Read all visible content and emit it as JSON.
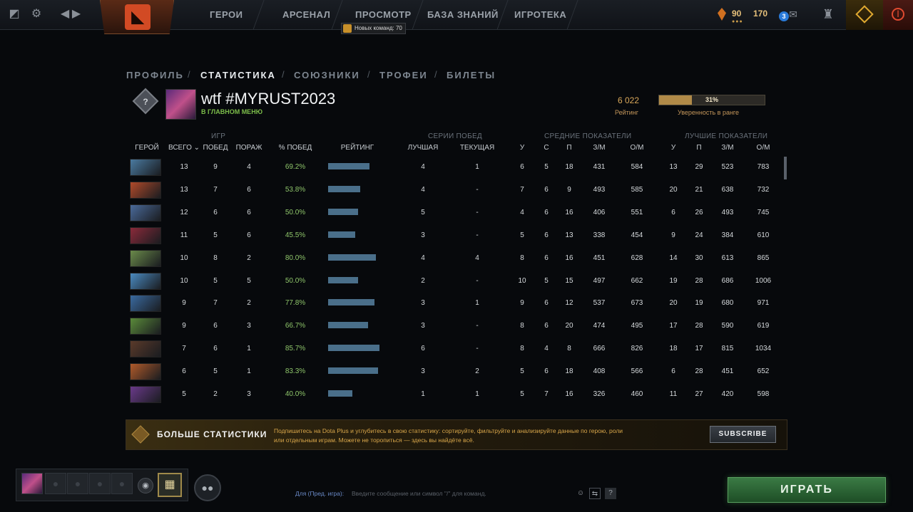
{
  "topbar": {
    "nav": [
      "ГЕРОИ",
      "АРСЕНАЛ",
      "ПРОСМОТР",
      "БАЗА ЗНАНИЙ",
      "ИГРОТЕКА"
    ],
    "notification": "Новых команд: 70",
    "currency_1": "90",
    "currency_2": "170",
    "badge_count": "3",
    "icons": [
      "dota-logo-icon",
      "settings-icon",
      "back-icon",
      "forward-icon",
      "shards-icon",
      "mail-icon",
      "armory-icon",
      "dota-plus-icon",
      "power-icon"
    ]
  },
  "tabs": [
    "ПРОФИЛЬ",
    "СТАТИСТИКА",
    "СОЮЗНИКИ",
    "ТРОФЕИ",
    "БИЛЕТЫ"
  ],
  "active_tab": "СТАТИСТИКА",
  "profile": {
    "name": "wtf #MYRUST2023",
    "status": "В ГЛАВНОМ МЕНЮ",
    "rating_value": "6 022",
    "rating_label": "Рейтинг",
    "confidence_value": "31%",
    "confidence_fraction": 0.31,
    "confidence_label": "Уверенность в ранге"
  },
  "table": {
    "groups": {
      "games": "ИГР",
      "streaks": "СЕРИИ ПОБЕД",
      "averages": "СРЕДНИЕ ПОКАЗАТЕЛИ",
      "bests": "ЛУЧШИЕ ПОКАЗАТЕЛИ"
    },
    "columns": [
      "ГЕРОЙ",
      "ВСЕГО",
      "ПОБЕД",
      "ПОРАЖ",
      "% ПОБЕД",
      "РЕЙТИНГ",
      "ЛУЧШАЯ",
      "ТЕКУЩАЯ",
      "У",
      "С",
      "П",
      "З/М",
      "О/М",
      "У",
      "П",
      "З/М",
      "О/М"
    ],
    "rows": [
      {
        "total": "13",
        "wins": "9",
        "losses": "4",
        "winrate": "69.2%",
        "rating": 0.69,
        "best": "4",
        "current": "1",
        "avg_k": "6",
        "avg_d": "5",
        "avg_a": "18",
        "avg_gpm": "431",
        "avg_xpm": "584",
        "best_k": "13",
        "best_a": "29",
        "best_gpm": "523",
        "best_xpm": "783"
      },
      {
        "total": "13",
        "wins": "7",
        "losses": "6",
        "winrate": "53.8%",
        "rating": 0.54,
        "best": "4",
        "current": "-",
        "avg_k": "7",
        "avg_d": "6",
        "avg_a": "9",
        "avg_gpm": "493",
        "avg_xpm": "585",
        "best_k": "20",
        "best_a": "21",
        "best_gpm": "638",
        "best_xpm": "732"
      },
      {
        "total": "12",
        "wins": "6",
        "losses": "6",
        "winrate": "50.0%",
        "rating": 0.5,
        "best": "5",
        "current": "-",
        "avg_k": "4",
        "avg_d": "6",
        "avg_a": "16",
        "avg_gpm": "406",
        "avg_xpm": "551",
        "best_k": "6",
        "best_a": "26",
        "best_gpm": "493",
        "best_xpm": "745"
      },
      {
        "total": "11",
        "wins": "5",
        "losses": "6",
        "winrate": "45.5%",
        "rating": 0.455,
        "best": "3",
        "current": "-",
        "avg_k": "5",
        "avg_d": "6",
        "avg_a": "13",
        "avg_gpm": "338",
        "avg_xpm": "454",
        "best_k": "9",
        "best_a": "24",
        "best_gpm": "384",
        "best_xpm": "610"
      },
      {
        "total": "10",
        "wins": "8",
        "losses": "2",
        "winrate": "80.0%",
        "rating": 0.8,
        "best": "4",
        "current": "4",
        "avg_k": "8",
        "avg_d": "6",
        "avg_a": "16",
        "avg_gpm": "451",
        "avg_xpm": "628",
        "best_k": "14",
        "best_a": "30",
        "best_gpm": "613",
        "best_xpm": "865"
      },
      {
        "total": "10",
        "wins": "5",
        "losses": "5",
        "winrate": "50.0%",
        "rating": 0.5,
        "best": "2",
        "current": "-",
        "avg_k": "10",
        "avg_d": "5",
        "avg_a": "15",
        "avg_gpm": "497",
        "avg_xpm": "662",
        "best_k": "19",
        "best_a": "28",
        "best_gpm": "686",
        "best_xpm": "1006"
      },
      {
        "total": "9",
        "wins": "7",
        "losses": "2",
        "winrate": "77.8%",
        "rating": 0.778,
        "best": "3",
        "current": "1",
        "avg_k": "9",
        "avg_d": "6",
        "avg_a": "12",
        "avg_gpm": "537",
        "avg_xpm": "673",
        "best_k": "20",
        "best_a": "19",
        "best_gpm": "680",
        "best_xpm": "971"
      },
      {
        "total": "9",
        "wins": "6",
        "losses": "3",
        "winrate": "66.7%",
        "rating": 0.667,
        "best": "3",
        "current": "-",
        "avg_k": "8",
        "avg_d": "6",
        "avg_a": "20",
        "avg_gpm": "474",
        "avg_xpm": "495",
        "best_k": "17",
        "best_a": "28",
        "best_gpm": "590",
        "best_xpm": "619"
      },
      {
        "total": "7",
        "wins": "6",
        "losses": "1",
        "winrate": "85.7%",
        "rating": 0.857,
        "best": "6",
        "current": "-",
        "avg_k": "8",
        "avg_d": "4",
        "avg_a": "8",
        "avg_gpm": "666",
        "avg_xpm": "826",
        "best_k": "18",
        "best_a": "17",
        "best_gpm": "815",
        "best_xpm": "1034"
      },
      {
        "total": "6",
        "wins": "5",
        "losses": "1",
        "winrate": "83.3%",
        "rating": 0.833,
        "best": "3",
        "current": "2",
        "avg_k": "5",
        "avg_d": "6",
        "avg_a": "18",
        "avg_gpm": "408",
        "avg_xpm": "566",
        "best_k": "6",
        "best_a": "28",
        "best_gpm": "451",
        "best_xpm": "652"
      },
      {
        "total": "5",
        "wins": "2",
        "losses": "3",
        "winrate": "40.0%",
        "rating": 0.4,
        "best": "1",
        "current": "1",
        "avg_k": "5",
        "avg_d": "7",
        "avg_a": "16",
        "avg_gpm": "326",
        "avg_xpm": "460",
        "best_k": "11",
        "best_a": "27",
        "best_gpm": "420",
        "best_xpm": "598"
      }
    ],
    "hero_colors": [
      "#4a7aa0",
      "#b04a2a",
      "#4a6a9a",
      "#8a2a3a",
      "#6a8a4a",
      "#4a8ac0",
      "#3a6aa0",
      "#5a8a3a",
      "#5a3a2a",
      "#b05a2a",
      "#6a3a8a"
    ]
  },
  "banner": {
    "title": "БОЛЬШЕ СТАТИСТИКИ",
    "description": "Подпишитесь на Dota Plus и углубитесь в свою статистику: сортируйте, фильтруйте и анализируйте данные по герою, роли или отдельным играм. Можете не торопиться — здесь вы найдёте всё.",
    "button": "SUBSCRIBE"
  },
  "bottom": {
    "chat_label": "Для (Пред. игра):",
    "chat_placeholder": "Введите сообщение или символ \"/\" для команд.",
    "play_button": "ИГРАТЬ"
  }
}
